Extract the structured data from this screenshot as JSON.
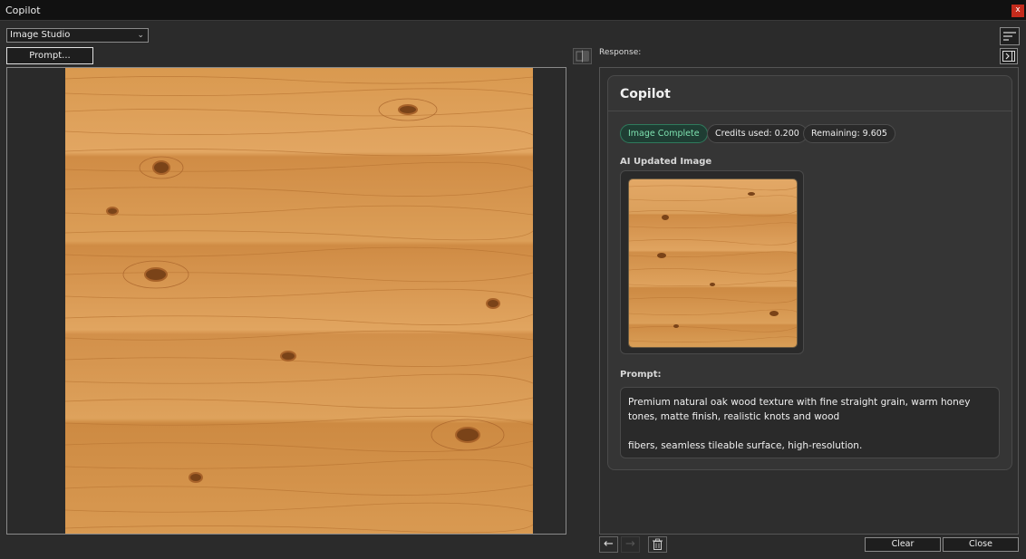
{
  "window": {
    "title": "Copilot",
    "close_glyph": "x"
  },
  "toolbar": {
    "mode_select": {
      "selected": "Image Studio"
    },
    "prompt_button": "Prompt...",
    "response_label": "Response:"
  },
  "response": {
    "card_title": "Copilot",
    "badges": {
      "status": "Image Complete",
      "credits_used": "Credits used: 0.200",
      "remaining": "Remaining: 9.605"
    },
    "image_label": "AI Updated Image",
    "prompt_label": "Prompt:",
    "prompt_text_1": "Premium natural oak wood texture with fine straight grain, warm honey tones, matte finish, realistic knots and wood",
    "prompt_text_2": "fibers, seamless tileable surface, high-resolution."
  },
  "footer": {
    "clear_label": "Clear",
    "close_label": "Close"
  },
  "icons": {
    "back": "arrow-left-icon",
    "forward": "arrow-right-icon",
    "delete": "trash-icon",
    "menu": "sort-lines-icon",
    "collapse": "panel-collapse-icon",
    "compare": "compare-icon",
    "dropdown": "chevron-down-icon"
  },
  "colors": {
    "background": "#2b2b2b",
    "titlebar": "#111111",
    "accent_success": "#7ee2b0",
    "close_red": "#c42b1c",
    "wood_base": "#d99a52"
  }
}
